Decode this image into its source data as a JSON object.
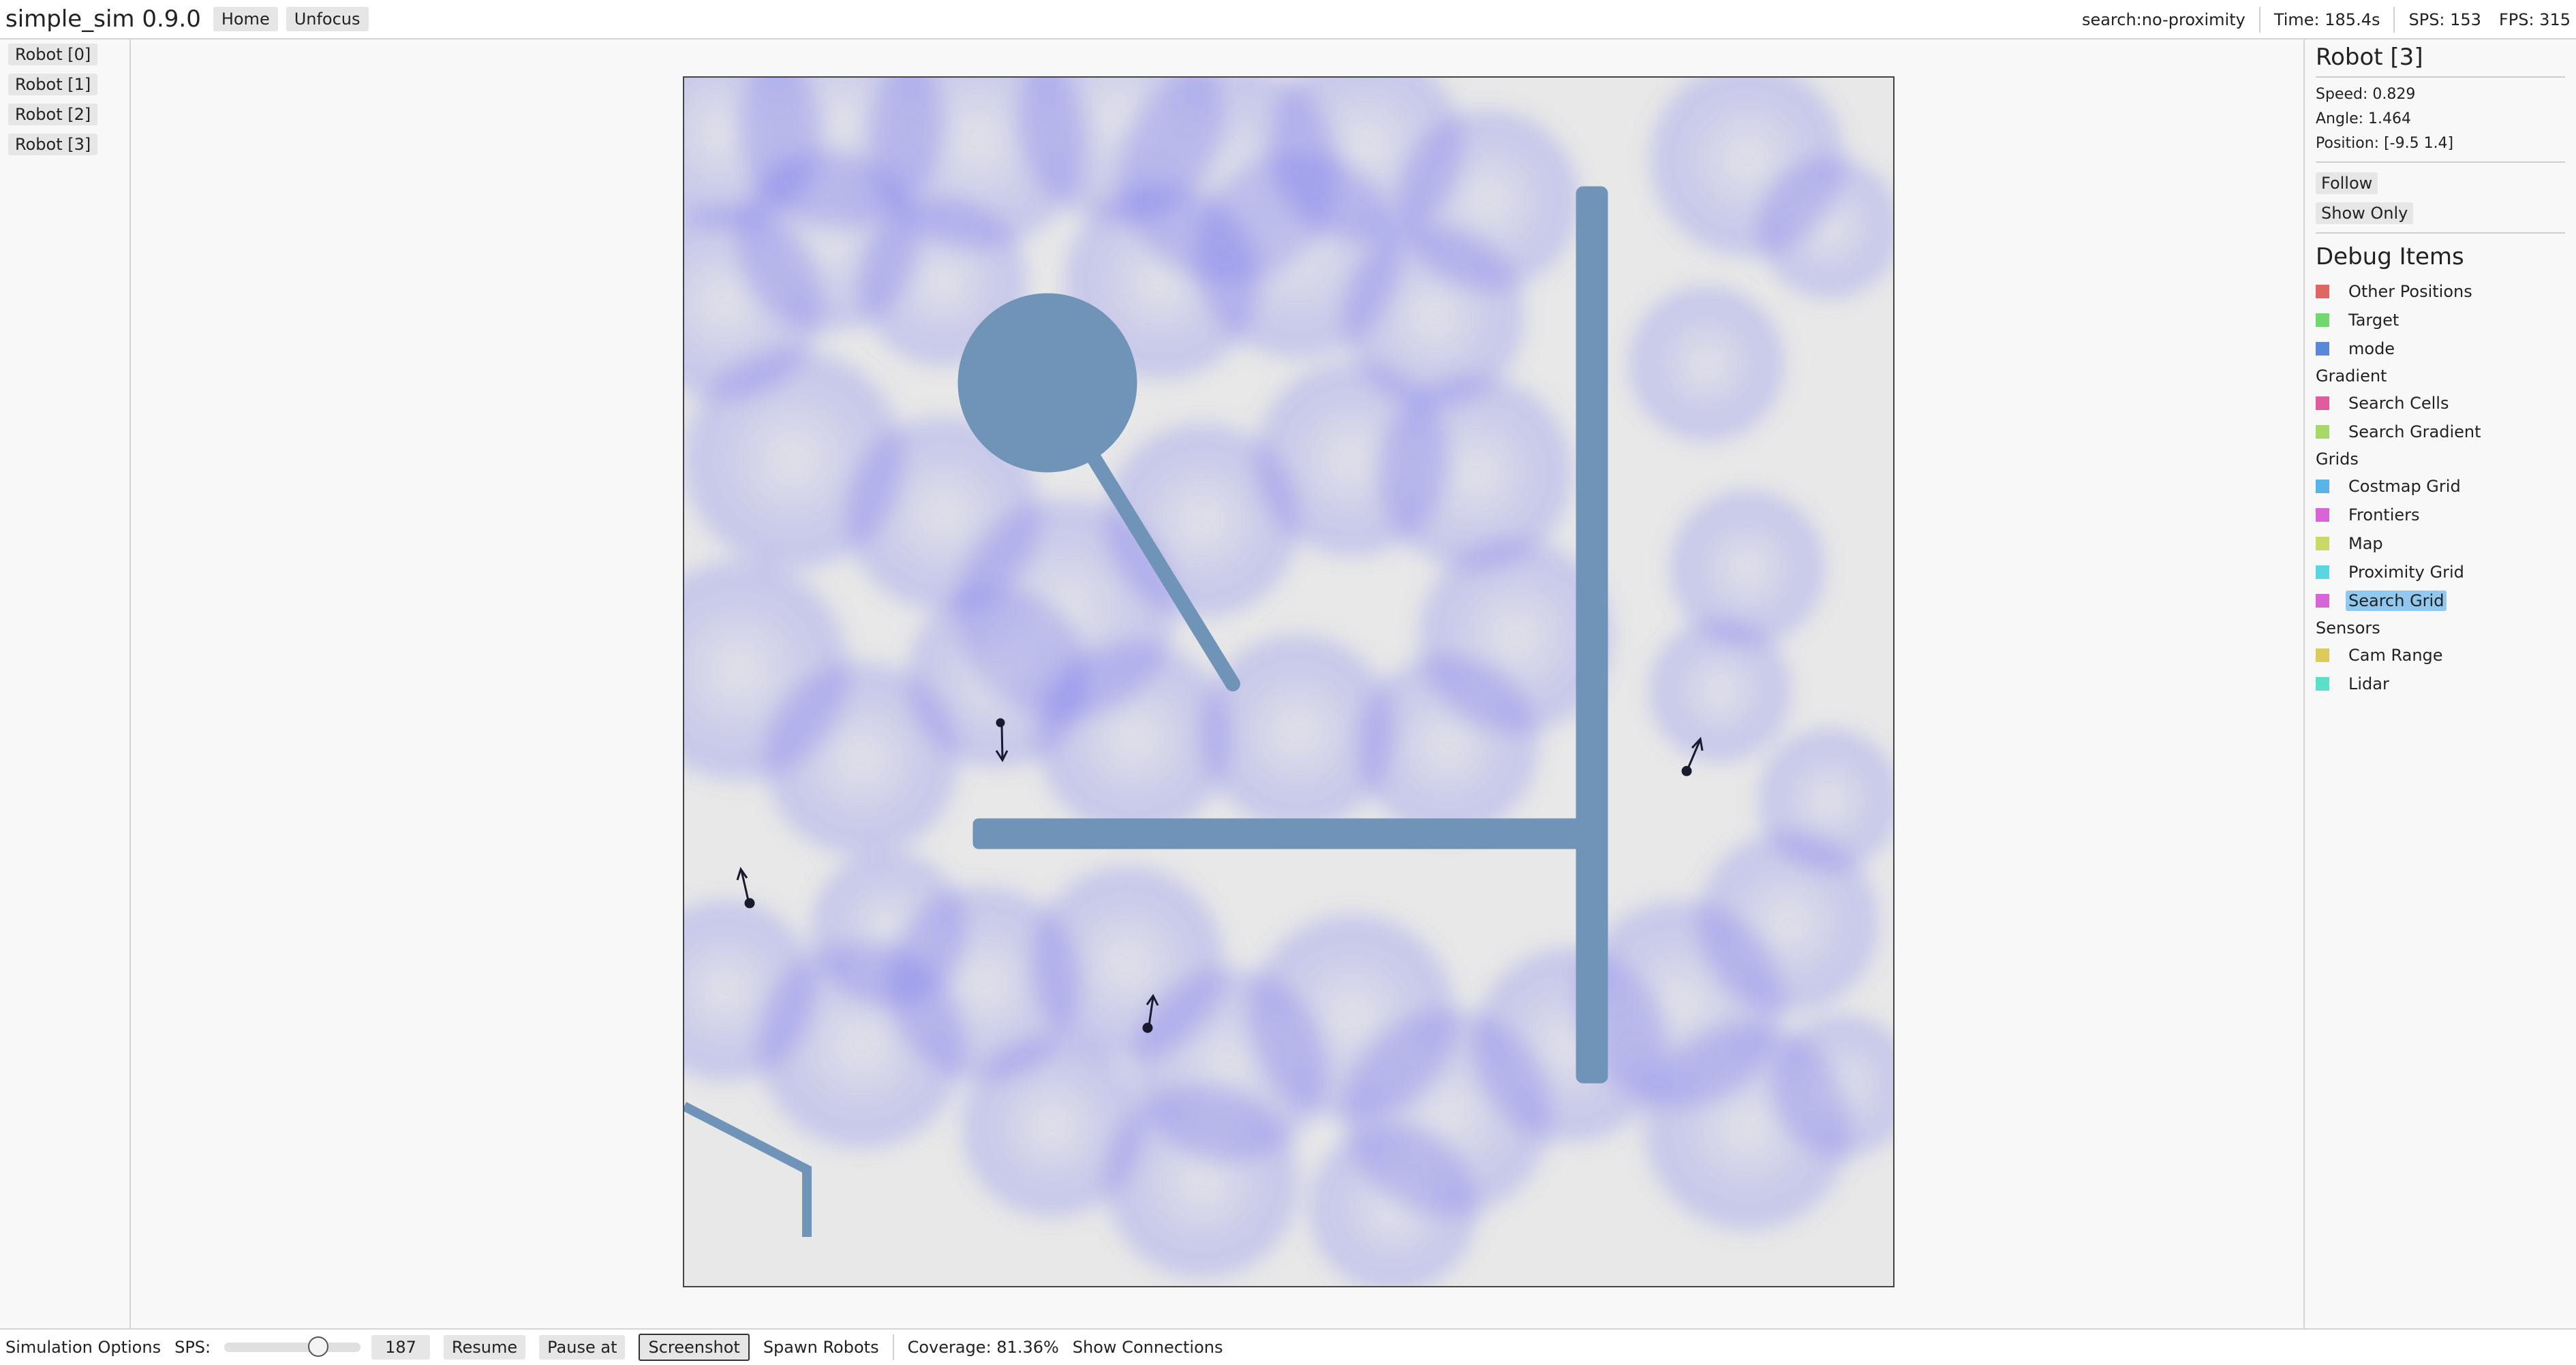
{
  "app": {
    "title": "simple_sim 0.9.0",
    "home_label": "Home",
    "unfocus_label": "Unfocus"
  },
  "status": {
    "mode": "search:no-proximity",
    "time": "Time: 185.4s",
    "sps": "SPS: 153",
    "fps": "FPS: 315"
  },
  "robots": [
    "Robot [0]",
    "Robot [1]",
    "Robot [2]",
    "Robot [3]"
  ],
  "focus": {
    "title": "Robot [3]",
    "speed": "Speed: 0.829",
    "angle": "Angle: 1.464",
    "position": "Position: [-9.5 1.4]",
    "follow_label": "Follow",
    "show_only_label": "Show Only"
  },
  "debug": {
    "title": "Debug Items",
    "groups": {
      "gradient": "Gradient",
      "grids": "Grids",
      "sensors": "Sensors"
    },
    "items": [
      {
        "label": "Other Positions",
        "color": "#e06666"
      },
      {
        "label": "Target",
        "color": "#6fd86f"
      },
      {
        "label": "mode",
        "color": "#5b87d8"
      },
      {
        "label": "Search Cells",
        "color": "#e05c9c"
      },
      {
        "label": "Search Gradient",
        "color": "#a8d86a"
      },
      {
        "label": "Costmap Grid",
        "color": "#5ab4e6"
      },
      {
        "label": "Frontiers",
        "color": "#d865d8"
      },
      {
        "label": "Map",
        "color": "#cad865"
      },
      {
        "label": "Proximity Grid",
        "color": "#5ad6e0"
      },
      {
        "label": "Search Grid",
        "color": "#d865d8",
        "selected": true
      },
      {
        "label": "Cam Range",
        "color": "#dcca5a"
      },
      {
        "label": "Lidar",
        "color": "#5ae0c6"
      }
    ]
  },
  "sim_options": {
    "label": "Simulation Options",
    "sps_label": "SPS:",
    "sps_value": "187",
    "sps_slider_fraction": 0.72,
    "resume_label": "Resume",
    "pause_at_label": "Pause at",
    "screenshot_label": "Screenshot",
    "spawn_label": "Spawn Robots",
    "coverage": "Coverage: 81.36%",
    "connections_label": "Show Connections"
  },
  "colors": {
    "obstacle": "#7094b8",
    "search_blob": "#6e6ef0",
    "world_bg": "#e8e8e8"
  }
}
